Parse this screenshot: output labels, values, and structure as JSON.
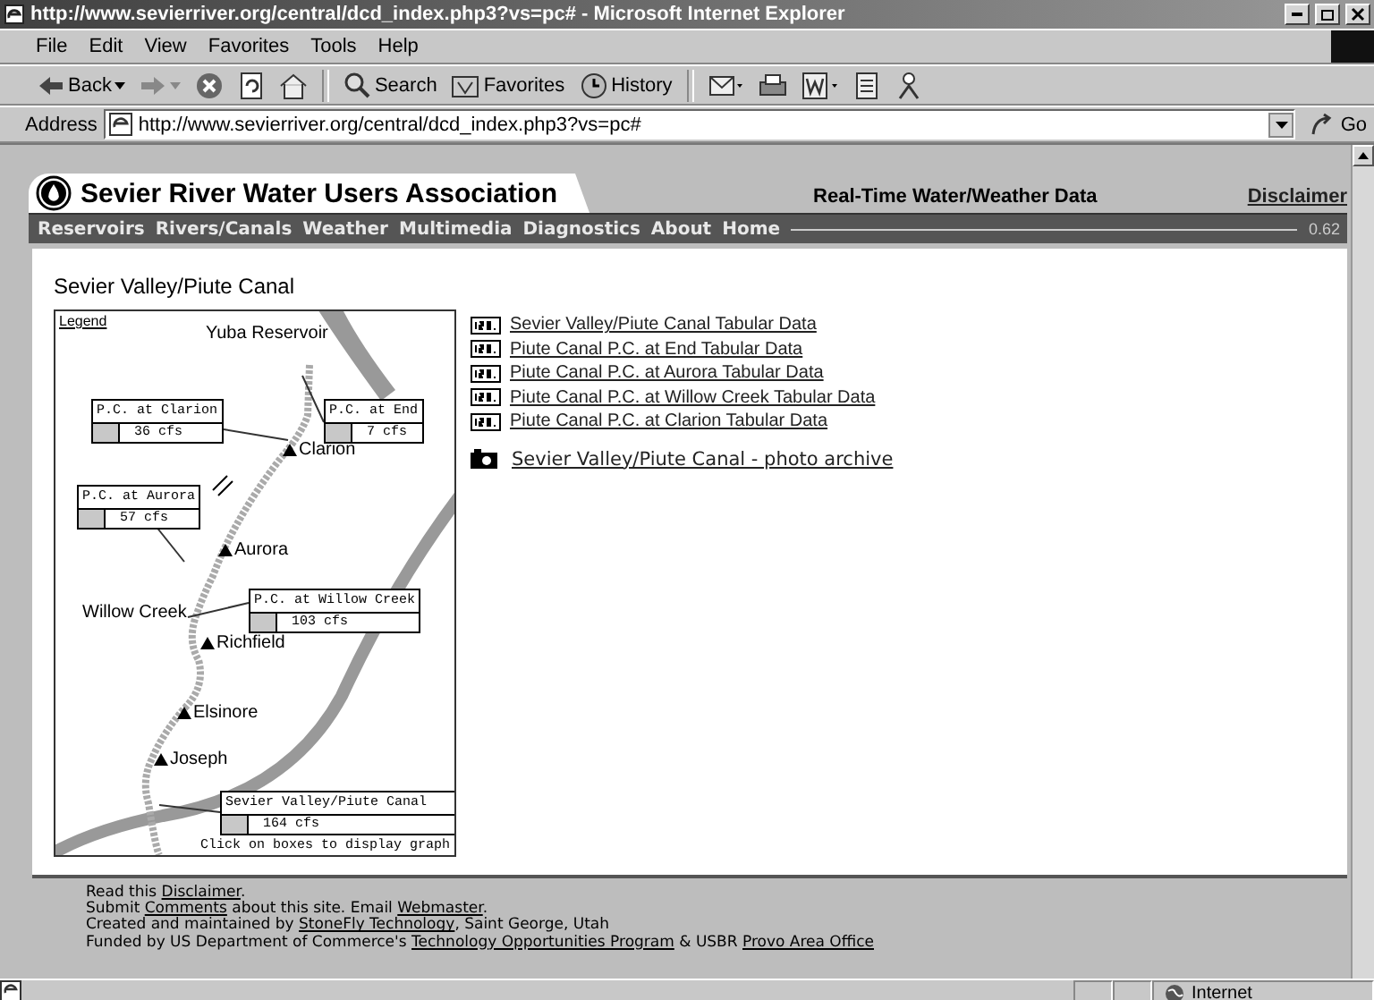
{
  "browser": {
    "title": "http://www.sevierriver.org/central/dcd_index.php3?vs=pc# - Microsoft Internet Explorer",
    "menu": [
      "File",
      "Edit",
      "View",
      "Favorites",
      "Tools",
      "Help"
    ],
    "toolbar": [
      {
        "kind": "back",
        "label": "Back"
      },
      {
        "kind": "forward"
      },
      {
        "kind": "stop"
      },
      {
        "kind": "refresh"
      },
      {
        "kind": "home"
      },
      {
        "kind": "search",
        "label": "Search"
      },
      {
        "kind": "favorites",
        "label": "Favorites"
      },
      {
        "kind": "history",
        "label": "History"
      },
      {
        "kind": "mail"
      },
      {
        "kind": "print"
      },
      {
        "kind": "edit"
      },
      {
        "kind": "discuss"
      },
      {
        "kind": "messenger"
      }
    ],
    "address_label": "Address",
    "address": "http://www.sevierriver.org/central/dcd_index.php3?vs=pc#",
    "go": "Go",
    "zone": "Internet"
  },
  "site": {
    "name": "Sevier River Water Users Association",
    "tagline": "Real-Time Water/Weather Data",
    "disclaimer": "Disclaimer",
    "nav": [
      "Reservoirs",
      "Rivers/Canals",
      "Weather",
      "Multimedia",
      "Diagnostics",
      "About",
      "Home"
    ],
    "version": "0.62"
  },
  "page_title": "Sevier Valley/Piute Canal",
  "map": {
    "legend": "Legend",
    "places": [
      {
        "name": "Yuba Reservoir",
        "kind": "label"
      },
      {
        "name": "Clarion",
        "kind": "town"
      },
      {
        "name": "Aurora",
        "kind": "town"
      },
      {
        "name": "Willow Creek",
        "kind": "label"
      },
      {
        "name": "Richfield",
        "kind": "town"
      },
      {
        "name": "Elsinore",
        "kind": "town"
      },
      {
        "name": "Joseph",
        "kind": "town"
      }
    ],
    "gauges": [
      {
        "name": "P.C. at Clarion",
        "reading": "36 cfs"
      },
      {
        "name": "P.C. at End",
        "reading": "7 cfs"
      },
      {
        "name": "P.C. at Aurora",
        "reading": "57 cfs"
      },
      {
        "name": "P.C. at Willow Creek",
        "reading": "103 cfs"
      },
      {
        "name": "Sevier Valley/Piute Canal",
        "reading": "164 cfs"
      }
    ],
    "hint": "Click on boxes to display graph"
  },
  "links": [
    "Sevier Valley/Piute Canal Tabular Data",
    "Piute Canal P.C. at End Tabular Data",
    "Piute Canal P.C. at Aurora Tabular Data",
    "Piute Canal P.C. at Willow Creek Tabular Data",
    "Piute Canal P.C. at Clarion Tabular Data"
  ],
  "photo_link": "Sevier Valley/Piute Canal - photo archive",
  "footer": [
    [
      {
        "text": "Read this "
      },
      {
        "text": "Disclaimer",
        "link": true
      },
      {
        "text": "."
      }
    ],
    [
      {
        "text": "Submit "
      },
      {
        "text": "Comments",
        "link": true
      },
      {
        "text": " about this site. Email "
      },
      {
        "text": "Webmaster",
        "link": true
      },
      {
        "text": "."
      }
    ],
    [
      {
        "text": "Created and maintained by "
      },
      {
        "text": "StoneFly Technology",
        "link": true
      },
      {
        "text": ", Saint George, Utah"
      }
    ],
    [
      {
        "text": "Funded by US Department of Commerce's "
      },
      {
        "text": "Technology Opportunities Program",
        "link": true
      },
      {
        "text": " & USBR "
      },
      {
        "text": "Provo Area Office",
        "link": true
      }
    ]
  ]
}
